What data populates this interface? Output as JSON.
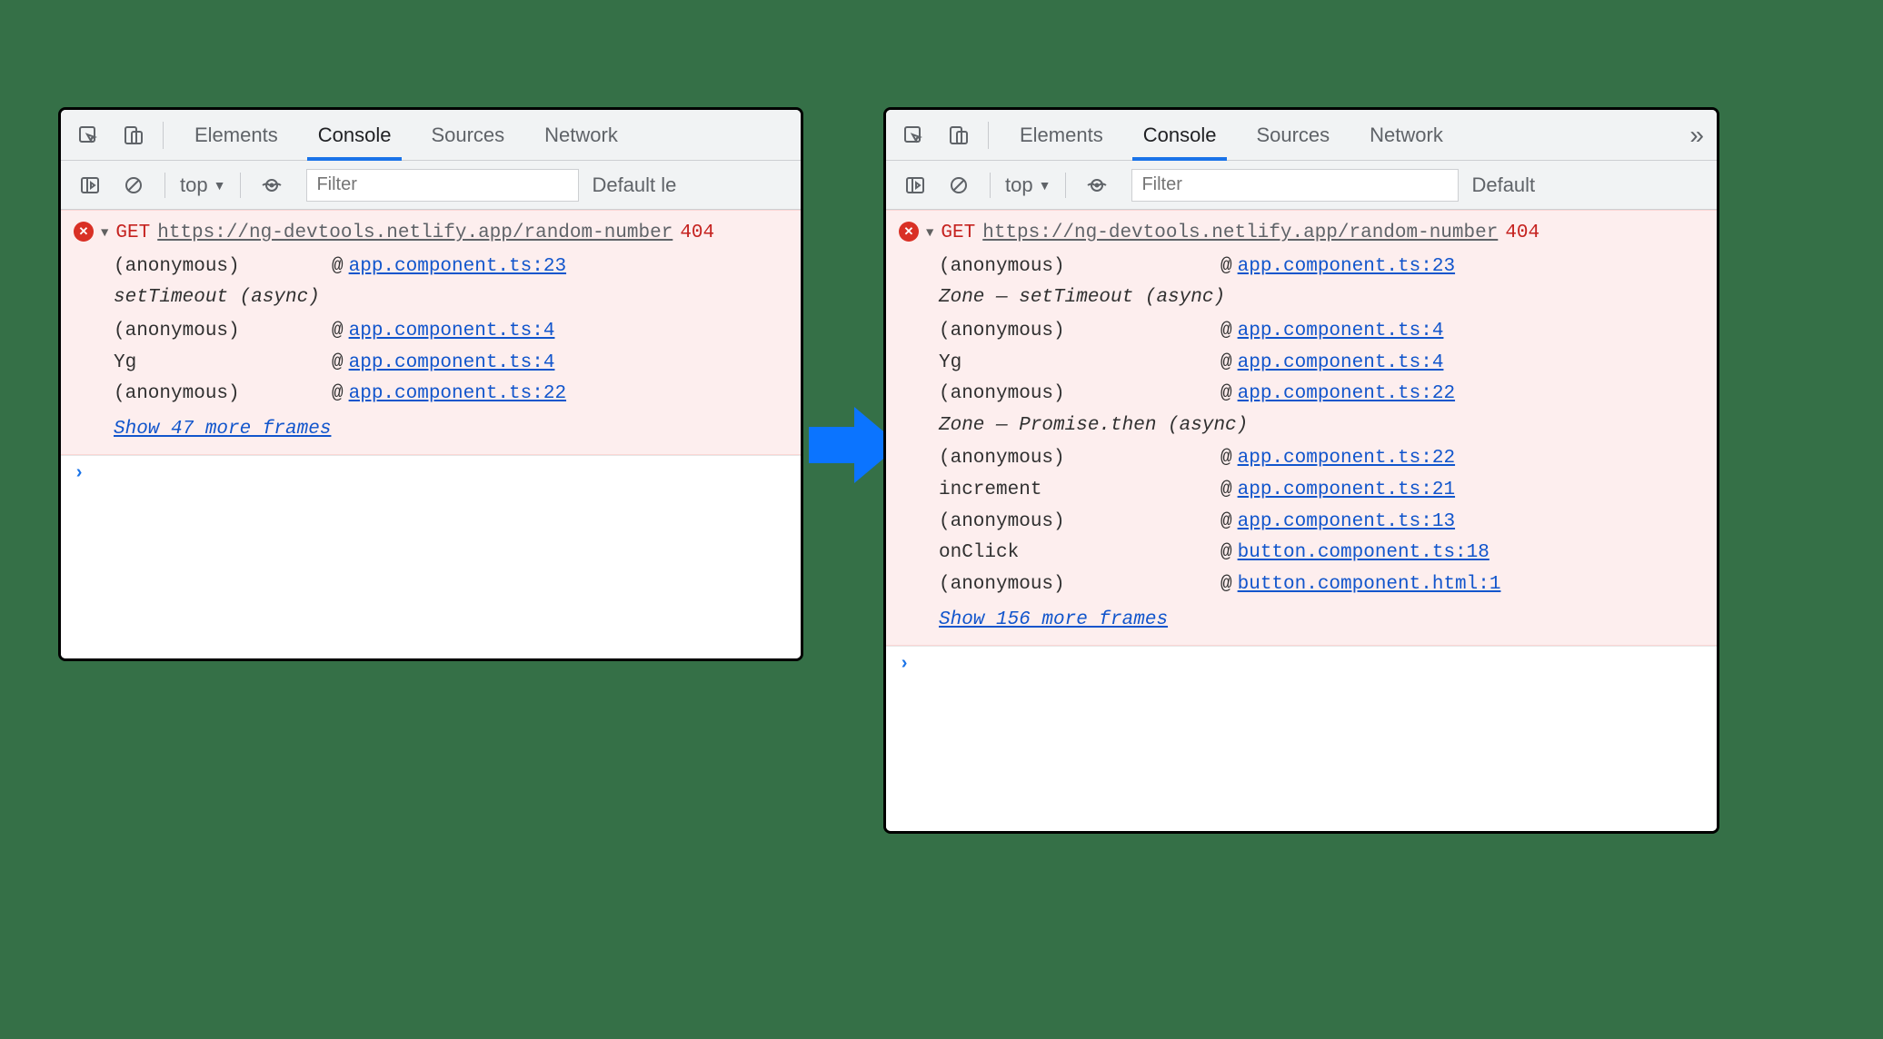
{
  "tabs": {
    "elements": "Elements",
    "console": "Console",
    "sources": "Sources",
    "network": "Network",
    "more": "»"
  },
  "filterbar": {
    "context": "top",
    "filter_placeholder": "Filter",
    "levels_left": "Default le",
    "levels_right": "Default"
  },
  "left": {
    "method": "GET",
    "url": "https://ng-devtools.netlify.app/random-number",
    "status": "404",
    "async_labels": {
      "a1": "setTimeout (async)"
    },
    "frames": [
      {
        "fn": "(anonymous)",
        "loc": "app.component.ts:23"
      }
    ],
    "frames2": [
      {
        "fn": "(anonymous)",
        "loc": "app.component.ts:4"
      },
      {
        "fn": "Yg",
        "loc": "app.component.ts:4"
      },
      {
        "fn": "(anonymous)",
        "loc": "app.component.ts:22"
      }
    ],
    "show_more": "Show 47 more frames"
  },
  "right": {
    "method": "GET",
    "url": "https://ng-devtools.netlify.app/random-number",
    "status": "404",
    "async_labels": {
      "a1": "Zone — setTimeout (async)",
      "a2": "Zone — Promise.then (async)"
    },
    "frames": [
      {
        "fn": "(anonymous)",
        "loc": "app.component.ts:23"
      }
    ],
    "frames2": [
      {
        "fn": "(anonymous)",
        "loc": "app.component.ts:4"
      },
      {
        "fn": "Yg",
        "loc": "app.component.ts:4"
      },
      {
        "fn": "(anonymous)",
        "loc": "app.component.ts:22"
      }
    ],
    "frames3": [
      {
        "fn": "(anonymous)",
        "loc": "app.component.ts:22"
      },
      {
        "fn": "increment",
        "loc": "app.component.ts:21"
      },
      {
        "fn": "(anonymous)",
        "loc": "app.component.ts:13"
      },
      {
        "fn": "onClick",
        "loc": "button.component.ts:18"
      },
      {
        "fn": "(anonymous)",
        "loc": "button.component.html:1"
      }
    ],
    "show_more": "Show 156 more frames"
  }
}
